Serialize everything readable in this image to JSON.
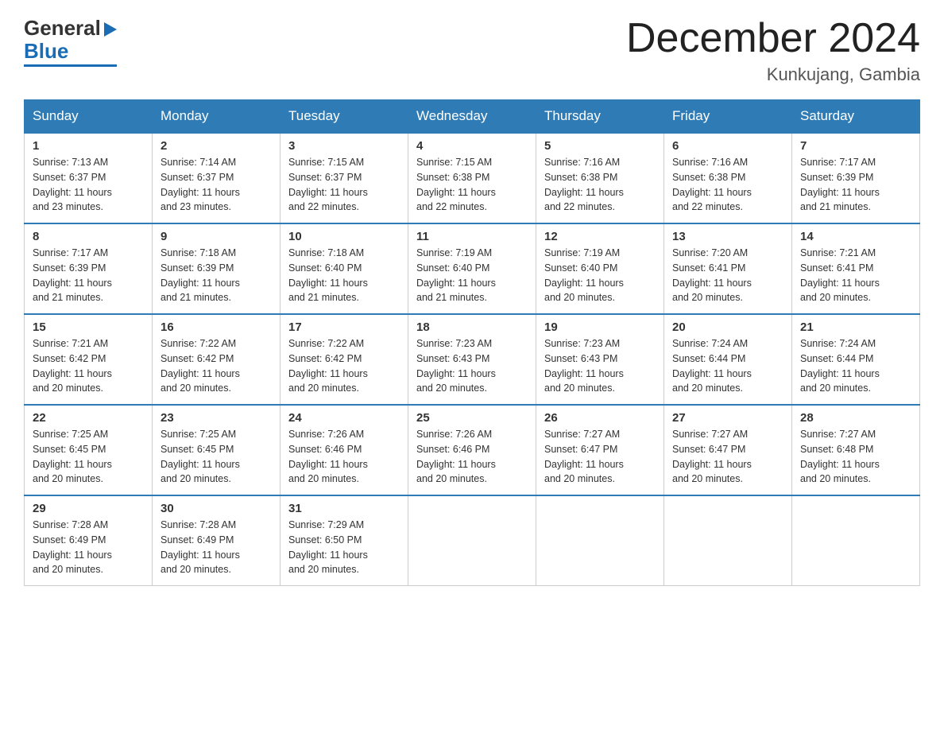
{
  "header": {
    "logo_general": "General",
    "logo_blue": "Blue",
    "month_title": "December 2024",
    "location": "Kunkujang, Gambia"
  },
  "days_of_week": [
    "Sunday",
    "Monday",
    "Tuesday",
    "Wednesday",
    "Thursday",
    "Friday",
    "Saturday"
  ],
  "weeks": [
    [
      {
        "num": "1",
        "info": "Sunrise: 7:13 AM\nSunset: 6:37 PM\nDaylight: 11 hours\nand 23 minutes."
      },
      {
        "num": "2",
        "info": "Sunrise: 7:14 AM\nSunset: 6:37 PM\nDaylight: 11 hours\nand 23 minutes."
      },
      {
        "num": "3",
        "info": "Sunrise: 7:15 AM\nSunset: 6:37 PM\nDaylight: 11 hours\nand 22 minutes."
      },
      {
        "num": "4",
        "info": "Sunrise: 7:15 AM\nSunset: 6:38 PM\nDaylight: 11 hours\nand 22 minutes."
      },
      {
        "num": "5",
        "info": "Sunrise: 7:16 AM\nSunset: 6:38 PM\nDaylight: 11 hours\nand 22 minutes."
      },
      {
        "num": "6",
        "info": "Sunrise: 7:16 AM\nSunset: 6:38 PM\nDaylight: 11 hours\nand 22 minutes."
      },
      {
        "num": "7",
        "info": "Sunrise: 7:17 AM\nSunset: 6:39 PM\nDaylight: 11 hours\nand 21 minutes."
      }
    ],
    [
      {
        "num": "8",
        "info": "Sunrise: 7:17 AM\nSunset: 6:39 PM\nDaylight: 11 hours\nand 21 minutes."
      },
      {
        "num": "9",
        "info": "Sunrise: 7:18 AM\nSunset: 6:39 PM\nDaylight: 11 hours\nand 21 minutes."
      },
      {
        "num": "10",
        "info": "Sunrise: 7:18 AM\nSunset: 6:40 PM\nDaylight: 11 hours\nand 21 minutes."
      },
      {
        "num": "11",
        "info": "Sunrise: 7:19 AM\nSunset: 6:40 PM\nDaylight: 11 hours\nand 21 minutes."
      },
      {
        "num": "12",
        "info": "Sunrise: 7:19 AM\nSunset: 6:40 PM\nDaylight: 11 hours\nand 20 minutes."
      },
      {
        "num": "13",
        "info": "Sunrise: 7:20 AM\nSunset: 6:41 PM\nDaylight: 11 hours\nand 20 minutes."
      },
      {
        "num": "14",
        "info": "Sunrise: 7:21 AM\nSunset: 6:41 PM\nDaylight: 11 hours\nand 20 minutes."
      }
    ],
    [
      {
        "num": "15",
        "info": "Sunrise: 7:21 AM\nSunset: 6:42 PM\nDaylight: 11 hours\nand 20 minutes."
      },
      {
        "num": "16",
        "info": "Sunrise: 7:22 AM\nSunset: 6:42 PM\nDaylight: 11 hours\nand 20 minutes."
      },
      {
        "num": "17",
        "info": "Sunrise: 7:22 AM\nSunset: 6:42 PM\nDaylight: 11 hours\nand 20 minutes."
      },
      {
        "num": "18",
        "info": "Sunrise: 7:23 AM\nSunset: 6:43 PM\nDaylight: 11 hours\nand 20 minutes."
      },
      {
        "num": "19",
        "info": "Sunrise: 7:23 AM\nSunset: 6:43 PM\nDaylight: 11 hours\nand 20 minutes."
      },
      {
        "num": "20",
        "info": "Sunrise: 7:24 AM\nSunset: 6:44 PM\nDaylight: 11 hours\nand 20 minutes."
      },
      {
        "num": "21",
        "info": "Sunrise: 7:24 AM\nSunset: 6:44 PM\nDaylight: 11 hours\nand 20 minutes."
      }
    ],
    [
      {
        "num": "22",
        "info": "Sunrise: 7:25 AM\nSunset: 6:45 PM\nDaylight: 11 hours\nand 20 minutes."
      },
      {
        "num": "23",
        "info": "Sunrise: 7:25 AM\nSunset: 6:45 PM\nDaylight: 11 hours\nand 20 minutes."
      },
      {
        "num": "24",
        "info": "Sunrise: 7:26 AM\nSunset: 6:46 PM\nDaylight: 11 hours\nand 20 minutes."
      },
      {
        "num": "25",
        "info": "Sunrise: 7:26 AM\nSunset: 6:46 PM\nDaylight: 11 hours\nand 20 minutes."
      },
      {
        "num": "26",
        "info": "Sunrise: 7:27 AM\nSunset: 6:47 PM\nDaylight: 11 hours\nand 20 minutes."
      },
      {
        "num": "27",
        "info": "Sunrise: 7:27 AM\nSunset: 6:47 PM\nDaylight: 11 hours\nand 20 minutes."
      },
      {
        "num": "28",
        "info": "Sunrise: 7:27 AM\nSunset: 6:48 PM\nDaylight: 11 hours\nand 20 minutes."
      }
    ],
    [
      {
        "num": "29",
        "info": "Sunrise: 7:28 AM\nSunset: 6:49 PM\nDaylight: 11 hours\nand 20 minutes."
      },
      {
        "num": "30",
        "info": "Sunrise: 7:28 AM\nSunset: 6:49 PM\nDaylight: 11 hours\nand 20 minutes."
      },
      {
        "num": "31",
        "info": "Sunrise: 7:29 AM\nSunset: 6:50 PM\nDaylight: 11 hours\nand 20 minutes."
      },
      null,
      null,
      null,
      null
    ]
  ]
}
